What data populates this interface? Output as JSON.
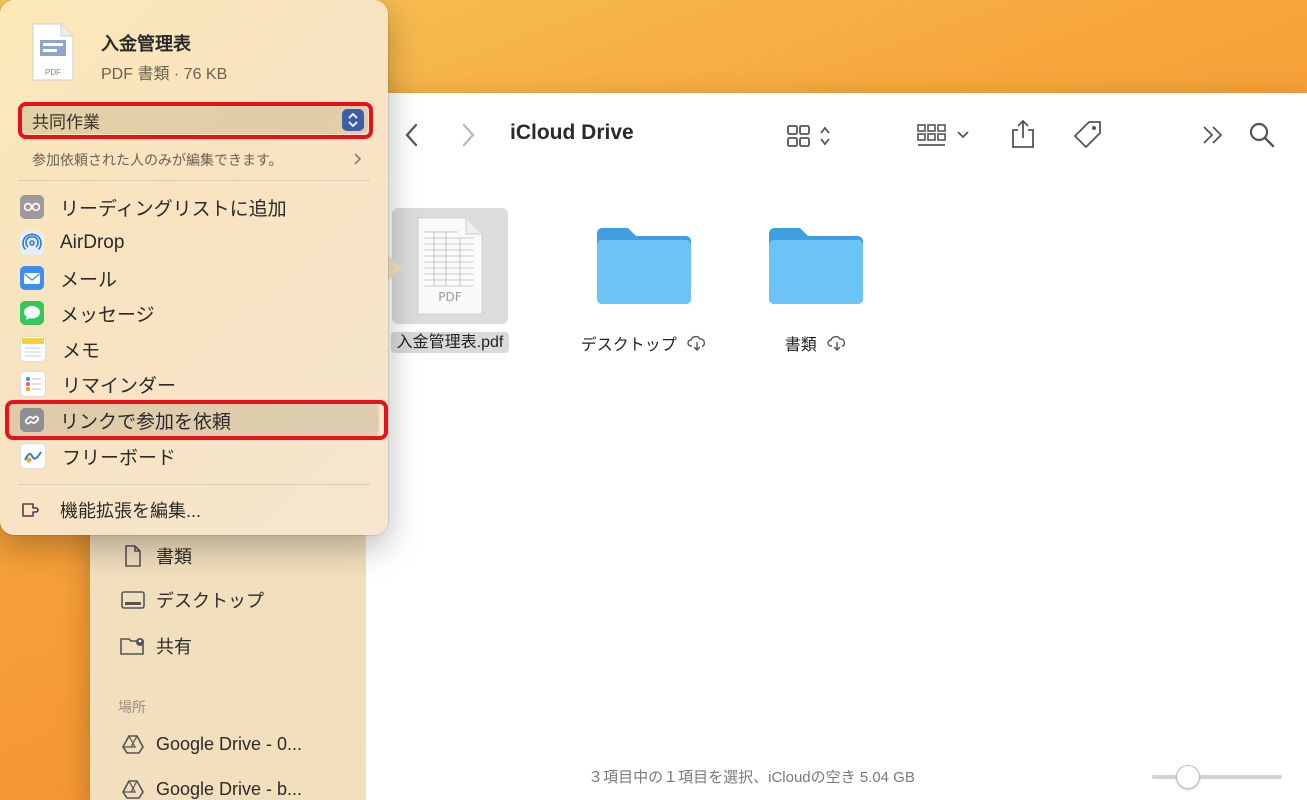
{
  "finder": {
    "title": "iCloud Drive",
    "files": [
      {
        "name": "入金管理表.pdf",
        "kind": "pdf",
        "selected": true,
        "icon_label": "PDF"
      },
      {
        "name": "デスクトップ",
        "kind": "folder",
        "cloud": true
      },
      {
        "name": "書類",
        "kind": "folder",
        "cloud": true
      }
    ],
    "status": "３項目中の１項目を選択、iCloudの空き 5.04 GB"
  },
  "sidebar": {
    "items": [
      {
        "label": "書類",
        "icon": "document-icon"
      },
      {
        "label": "デスクトップ",
        "icon": "desktop-icon"
      },
      {
        "label": "共有",
        "icon": "shared-folder-icon"
      }
    ],
    "locations_heading": "場所",
    "locations": [
      {
        "label": "Google Drive - 0...",
        "icon": "google-drive-icon"
      },
      {
        "label": "Google Drive - b...",
        "icon": "google-drive-icon"
      }
    ]
  },
  "share": {
    "file_name": "入金管理表",
    "file_info": "PDF 書類 · 76 KB",
    "file_icon_label": "PDF",
    "collab_mode": "共同作業",
    "permission_text": "参加依頼された人のみが編集できます。",
    "menu": [
      {
        "label": "リーディングリストに追加",
        "icon": "reading-list-icon"
      },
      {
        "label": "AirDrop",
        "icon": "airdrop-icon"
      },
      {
        "label": "メール",
        "icon": "mail-icon"
      },
      {
        "label": "メッセージ",
        "icon": "messages-icon"
      },
      {
        "label": "メモ",
        "icon": "notes-icon"
      },
      {
        "label": "リマインダー",
        "icon": "reminders-icon"
      },
      {
        "label": "リンクで参加を依頼",
        "icon": "link-icon"
      },
      {
        "label": "フリーボード",
        "icon": "freeform-icon"
      }
    ],
    "edit_extensions": "機能拡張を編集..."
  },
  "colors": {
    "highlight": "#e8101a",
    "folder": "#5fb7ee",
    "select_button": "#3c5fa8"
  }
}
